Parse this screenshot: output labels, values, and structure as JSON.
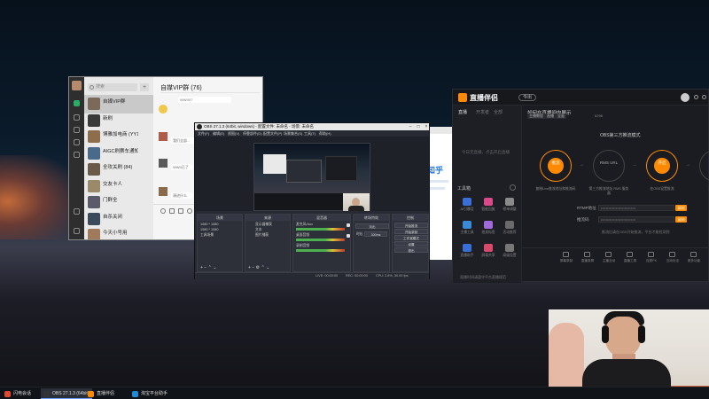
{
  "wechat": {
    "search_placeholder": "搜索",
    "chat_title": "自媒VIP群 (76)",
    "input_hint": "WWII07",
    "msg2": "我们全部...",
    "msg3": "WWII已了",
    "msg4": "演进什么",
    "chats": [
      {
        "name": "自媒VIP群",
        "sub": "",
        "time": "",
        "color": "#7b6a5a"
      },
      {
        "name": "新刷",
        "sub": "",
        "time": "",
        "color": "#3a3a3a"
      },
      {
        "name": "博雅加电商 (YY107",
        "sub": "",
        "time": "",
        "color": "#8e6d4c"
      },
      {
        "name": "AIGC刷赛车通知",
        "sub": "",
        "time": "",
        "color": "#4a6a8a"
      },
      {
        "name": "全攻关刷 (84)",
        "sub": "",
        "time": "",
        "color": "#6a5a4a"
      },
      {
        "name": "交友卡人",
        "sub": "",
        "time": "",
        "color": "#9a8a6a"
      },
      {
        "name": "门群全",
        "sub": "",
        "time": "",
        "color": "#5a5a6a"
      },
      {
        "name": "自杀关闭",
        "sub": "",
        "time": "",
        "color": "#3a4a5a"
      },
      {
        "name": "今天小号用",
        "sub": "",
        "time": "",
        "color": "#a07a5a"
      }
    ]
  },
  "browser": {
    "brand": "知乎"
  },
  "live": {
    "app_name": "直播伴侣",
    "version_pill": "今出",
    "tabs": [
      "直播",
      "开发者",
      "全部"
    ],
    "empty_text": "今日无直播，点击开启直播",
    "toolbox_title": "工具箱",
    "tools": [
      {
        "label": "AI引爆话",
        "color": "#3b6fd8"
      },
      {
        "label": "智能回复",
        "color": "#d84a8a"
      },
      {
        "label": "榜单调整",
        "color": "#8a8a8a"
      },
      {
        "label": "主播工具",
        "color": "#3b8ad8"
      },
      {
        "label": "拍卖标签",
        "color": "#a06ad8"
      },
      {
        "label": "活动推荐",
        "color": "#6a6a6a"
      },
      {
        "label": "直播助手",
        "color": "#3b6fd8"
      },
      {
        "label": "屏幕共享",
        "color": "#d84a6a"
      },
      {
        "label": "高级设置",
        "color": "#777777"
      }
    ],
    "header_line": "如何在直播间内展示",
    "header_tags": [
      "主播教程",
      "直播",
      "全面"
    ],
    "header_stat": "6298",
    "steps_title": "OBS第三方推流模式",
    "step_labels": [
      "推流",
      "RMS URL",
      "开启",
      "点击"
    ],
    "step_caps": [
      "复制Live推流地址和推流码",
      "第三方推流地址 RMS 服务器",
      "在OBS设置推流",
      "开始直播"
    ],
    "fields": [
      {
        "label": "RTMP地址",
        "value": "••••••••••••••••••••••••••••",
        "btn": "复制"
      },
      {
        "label": "推流码",
        "value": "••••••••••••••••••••••••••••",
        "btn": "复制"
      }
    ],
    "note": "推流后请在OBS开始推流，平台才能检测到",
    "bottom_tools": [
      "屏幕录制",
      "直播录屏",
      "主播互动",
      "直播工具",
      "连麦PK",
      "互动玩法",
      "更多功能"
    ],
    "footer": "直播时间请遵守平台直播规范"
  },
  "obs": {
    "title": "OBS 27.1.3 (64bit, windows) - 配置文件: 未命名 - 场景: 未命名",
    "menu": [
      "文件(F)",
      "编辑(E)",
      "视图(V)",
      "停靠部件(D)",
      "配置文件(P)",
      "场景集合(S)",
      "工具(T)",
      "帮助(H)"
    ],
    "docks": {
      "scenes": {
        "title": "场景",
        "items": [
          "1080 * 1080",
          "1080 * 1080",
          "工具场景"
        ]
      },
      "sources": {
        "title": "来源",
        "items": [
          "显示器捕获",
          "文本",
          "图片捕获"
        ]
      },
      "mixer": {
        "title": "混音器",
        "items": [
          "麦克风/Aux",
          "桌面音频",
          "录制音频"
        ]
      },
      "transitions": {
        "title": "转场特效",
        "mode": "淡出",
        "duration_label": "时长",
        "duration": "300ms"
      },
      "controls": {
        "title": "控制",
        "buttons": [
          "开始推流",
          "开始录制",
          "工作室模式",
          "设置",
          "退出"
        ]
      }
    },
    "status": {
      "live": "LIVE: 00:00:00",
      "rec": "REC: 00:00:00",
      "cpu": "CPU: 2.8%, 30.00 fps"
    }
  },
  "taskbar": {
    "items": [
      {
        "label": "闪电会话",
        "color": "#e04a2a"
      },
      {
        "label": "OBS 27.1.3 (64bit)",
        "color": "#333333",
        "active": true
      },
      {
        "label": "直播伴侣",
        "color": "#ff8a00"
      },
      {
        "label": "淘宝平台助手",
        "color": "#1e8ad8"
      }
    ]
  }
}
